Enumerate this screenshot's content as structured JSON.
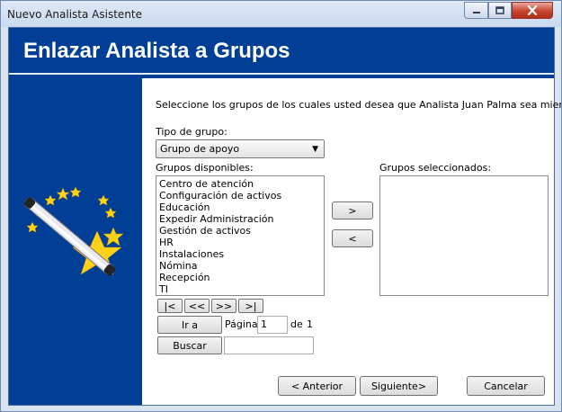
{
  "window": {
    "title": "Nuevo Analista Asistente"
  },
  "header": {
    "title": "Enlazar Analista a Grupos"
  },
  "instructions": "Seleccione los grupos de los cuales usted desea que Analista Juan Palma sea miembro.",
  "group_type": {
    "label": "Tipo de grupo:",
    "selected": "Grupo de apoyo"
  },
  "available": {
    "label": "Grupos disponibles:",
    "items": [
      "Centro de atención",
      "Configuración de activos",
      "Educación",
      "Expedir Administración",
      "Gestión de activos",
      "HR",
      "Instalaciones",
      "Nómina",
      "Recepción",
      "TI"
    ]
  },
  "selected": {
    "label": "Grupos seleccionados:",
    "items": []
  },
  "transfer": {
    "add": ">",
    "remove": "<"
  },
  "pager": {
    "first": "|<",
    "prev": "<<",
    "next": ">>",
    "last": ">|",
    "go_label": "Ir a",
    "page_label": "Página",
    "page_value": "1",
    "of_label": "de",
    "total_pages": "1"
  },
  "search": {
    "button": "Buscar",
    "value": ""
  },
  "footer": {
    "back": "< Anterior",
    "next": "Siguiente>",
    "cancel": "Cancelar"
  }
}
